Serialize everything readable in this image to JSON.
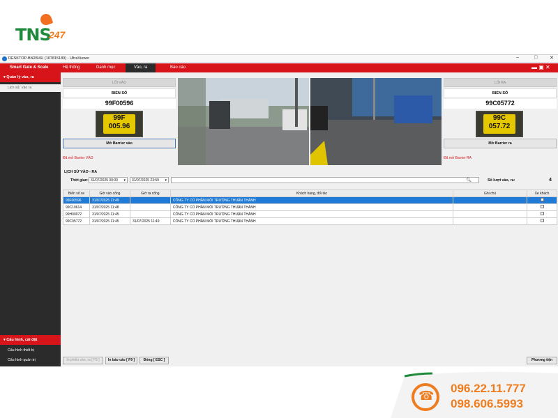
{
  "logo": {
    "brand": "TNS",
    "suffix": "247"
  },
  "window": {
    "title": "DESKTOP-BN28I4U (107815180) - UltraViewer",
    "ctrl_min": "–",
    "ctrl_max": "□",
    "ctrl_close": "✕"
  },
  "menu": {
    "app": "Smart Gate & Scale",
    "items": [
      "Hệ thống",
      "Danh mục",
      "Vào, ra",
      "Báo cáo"
    ]
  },
  "sidebar": {
    "section1": "Quản lý vào, ra",
    "section1_items": [
      "Lịch sử, vào ra"
    ],
    "section2": "Cấu hình, cài đặt",
    "section2_items": [
      "Cấu hình thiết bị",
      "Cấu hình quản trị"
    ]
  },
  "entry": {
    "lane_label": "LỐI VÀO",
    "plate_label": "BIỂN SỐ",
    "plate": "99F00596",
    "plate_line1": "99F",
    "plate_line2": "005.96",
    "button": "Mở Barrier vào",
    "status": "Đã mở Barrier VÀO"
  },
  "exit": {
    "lane_label": "LỐI RA",
    "plate_label": "BIỂN SỐ",
    "plate": "99C05772",
    "plate_line1": "99C",
    "plate_line2": "057.72",
    "button": "Mở Barrier ra",
    "status": "Đã mở Barrier RA"
  },
  "history": {
    "title": "LỊCH SỬ VÀO - RA",
    "time_label": "Thời gian:",
    "from": "31/07/2025 00:00",
    "to": "31/07/2025 23:59",
    "count_label": "Số lượt vào, ra:",
    "count": "4",
    "columns": [
      "Biển số xe",
      "Giờ vào cổng",
      "Giờ ra cổng",
      "Khách hàng, đối tác",
      "Ghi chú",
      "Xe khách"
    ],
    "rows": [
      [
        "99F00596",
        "31/07/2025 11:49",
        "",
        "CÔNG TY CỔ PHẦN MÔI TRƯỜNG THUẬN THÀNH",
        ""
      ],
      [
        "99C10614",
        "31/07/2025 11:48",
        "",
        "CÔNG TY CỔ PHẦN MÔI TRƯỜNG THUẬN THÀNH",
        ""
      ],
      [
        "99H00072",
        "31/07/2025 11:45",
        "",
        "CÔNG TY CỔ PHẦN MÔI TRƯỜNG THUẬN THÀNH",
        ""
      ],
      [
        "99C05772",
        "31/07/2025 11:45",
        "31/07/2025 11:49",
        "CÔNG TY CỔ PHẦN MÔI TRƯỜNG THUẬN THÀNH",
        ""
      ]
    ]
  },
  "footer": {
    "export": "In phiếu vào, ra [ F5 ]",
    "report": "In báo cáo [ F9 ]",
    "close": "Đóng [ ESC ]",
    "vehicles": "Phương tiện"
  },
  "contact": {
    "phone1": "096.22.11.777",
    "phone2": "098.606.5993"
  },
  "colors": {
    "accent": "#d7141a",
    "selected": "#1f7bd6",
    "phone": "#ef7d1f"
  }
}
